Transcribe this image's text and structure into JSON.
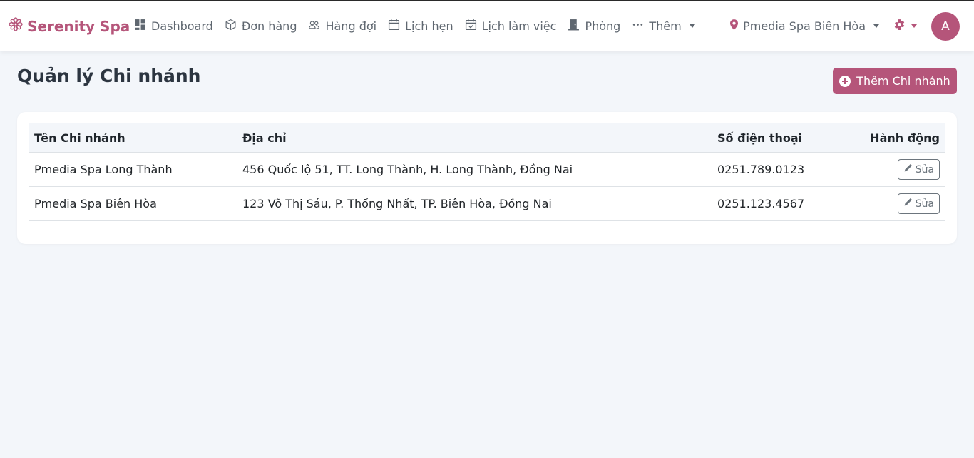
{
  "brand": {
    "name": "Serenity Spa",
    "icon": "flower-icon"
  },
  "nav": {
    "items": [
      {
        "label": "Dashboard",
        "icon": "dashboard-icon"
      },
      {
        "label": "Đơn hàng",
        "icon": "box-icon"
      },
      {
        "label": "Hàng đợi",
        "icon": "people-icon"
      },
      {
        "label": "Lịch hẹn",
        "icon": "calendar-icon"
      },
      {
        "label": "Lịch làm việc",
        "icon": "calendar-check-icon"
      },
      {
        "label": "Phòng",
        "icon": "door-icon"
      },
      {
        "label": "Thêm",
        "icon": "dots-icon"
      }
    ],
    "branch": "Pmedia Spa Biên Hòa",
    "avatar_initial": "A"
  },
  "page": {
    "title": "Quản lý Chi nhánh",
    "add_button": "Thêm Chi nhánh"
  },
  "table": {
    "headers": [
      "Tên Chi nhánh",
      "Địa chỉ",
      "Số điện thoại",
      "Hành động"
    ],
    "rows": [
      {
        "name": "Pmedia Spa Long Thành",
        "address": "456 Quốc lộ 51, TT. Long Thành, H. Long Thành, Đồng Nai",
        "phone": "0251.789.0123",
        "action": "Sửa"
      },
      {
        "name": "Pmedia Spa Biên Hòa",
        "address": "123 Võ Thị Sáu, P. Thống Nhất, TP. Biên Hòa, Đồng Nai",
        "phone": "0251.123.4567",
        "action": "Sửa"
      }
    ]
  },
  "colors": {
    "accent": "#b5557a",
    "background": "#f3f6fa",
    "nav_text": "#5f6770"
  }
}
